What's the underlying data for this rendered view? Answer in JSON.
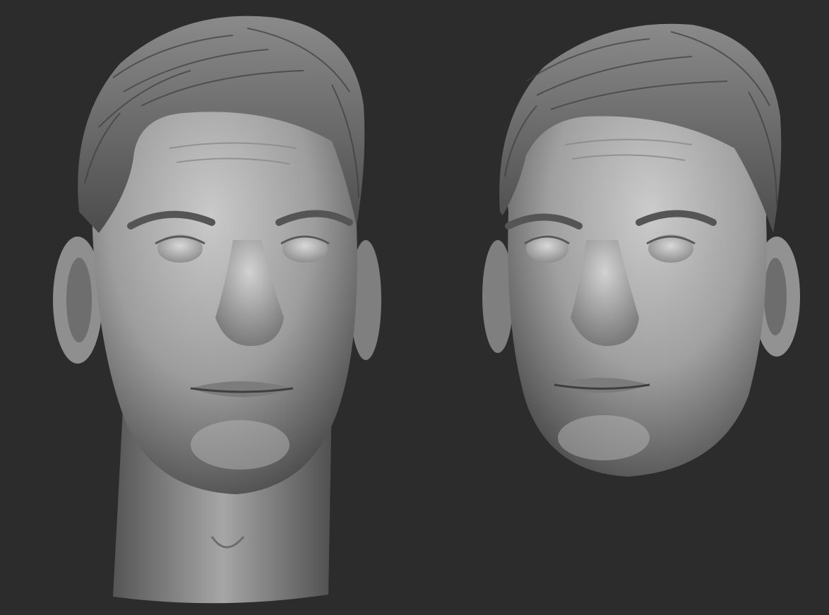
{
  "scene": {
    "background_color": "#2c2c2c",
    "material_color": "#9a9a9a",
    "highlight_color": "#cfcfcf",
    "shadow_color": "#3a3a3a",
    "hair_color": "#6e6e6e",
    "subjects": [
      {
        "name": "sculpted-head-with-neck",
        "shading": "matte-grey-clay"
      },
      {
        "name": "sculpted-face-mask",
        "shading": "matte-grey-clay"
      }
    ]
  }
}
